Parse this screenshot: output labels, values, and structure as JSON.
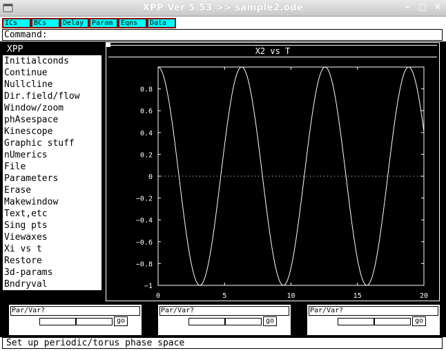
{
  "window": {
    "title": "XPP Ver 5.53 >> sample2.ode",
    "minimize_glyph": "–",
    "maximize_glyph": "□",
    "close_glyph": "✕"
  },
  "toolbar": {
    "buttons": [
      "ICs",
      "BCs",
      "Delay",
      "Param",
      "Eqns",
      "Data"
    ]
  },
  "command": {
    "label": "Command:"
  },
  "menu": {
    "header": "XPP",
    "items": [
      "Initialconds",
      "Continue",
      "Nullcline",
      "Dir.field/flow",
      "Window/zoom",
      "phAsespace",
      "Kinescope",
      "Graphic stuff",
      "nUmerics",
      "File",
      "Parameters",
      "Erase",
      "Makewindow",
      "Text,etc",
      "Sing pts",
      "Viewaxes",
      "Xi vs t",
      "Restore",
      "3d-params",
      "Bndryval"
    ]
  },
  "chart_data": {
    "type": "line",
    "title": "X2 vs T",
    "xlabel": "",
    "ylabel": "",
    "xlim": [
      0,
      20
    ],
    "ylim": [
      -1,
      1
    ],
    "x_ticks": [
      0,
      5,
      10,
      15,
      20
    ],
    "y_ticks": [
      0.8,
      0.6,
      0.4,
      0.2,
      0,
      -0.2,
      -0.4,
      -0.6,
      -0.8,
      -1
    ],
    "y_tick_labels": [
      "0.8",
      "0.6",
      "0.4",
      "0.2",
      "0",
      "−0.2",
      "−0.4",
      "−0.6",
      "−0.8",
      "−1"
    ],
    "x_tick_labels": [
      "0",
      "5",
      "10",
      "15",
      "20"
    ],
    "zero_line": "dotted",
    "series": [
      {
        "function": "cos",
        "x_range": [
          0,
          20
        ],
        "amplitude": 1,
        "period": 6.2832,
        "color": "#ffffff"
      }
    ]
  },
  "sliders": [
    {
      "label": "Par/Var?",
      "go": "go"
    },
    {
      "label": "Par/Var?",
      "go": "go"
    },
    {
      "label": "Par/Var?",
      "go": "go"
    }
  ],
  "status": {
    "text": "Set up periodic/torus phase space"
  },
  "colors": {
    "button_bg": "#00ffff",
    "button_border": "#8b0000",
    "plot_bg": "#000000",
    "plot_fg": "#ffffff"
  }
}
